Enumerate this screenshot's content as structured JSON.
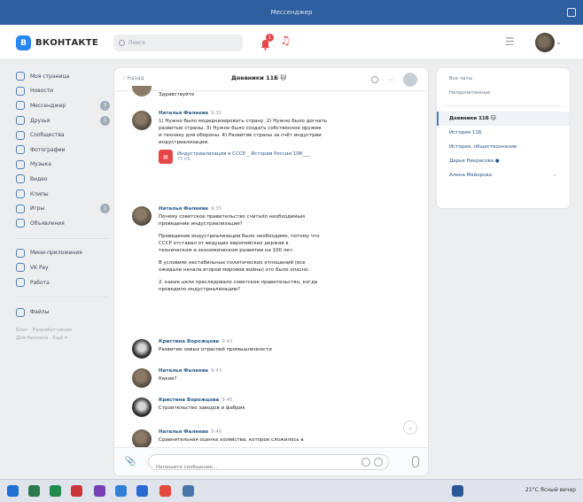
{
  "window": {
    "title": "Мессенджер"
  },
  "header": {
    "logo_text": "ВКОНТАКТЕ",
    "logo_letter": "В",
    "search_placeholder": "Поиск",
    "notif_count": "1",
    "accent": "#2787f5"
  },
  "leftnav": {
    "items": [
      {
        "label": "Моя страница",
        "icon": "home-icon"
      },
      {
        "label": "Новости",
        "icon": "news-icon"
      },
      {
        "label": "Мессенджер",
        "icon": "messenger-icon",
        "count": "3"
      },
      {
        "label": "Друзья",
        "icon": "friends-icon",
        "count": "1"
      },
      {
        "label": "Сообщества",
        "icon": "communities-icon"
      },
      {
        "label": "Фотографии",
        "icon": "photos-icon"
      },
      {
        "label": "Музыка",
        "icon": "music-icon"
      },
      {
        "label": "Видео",
        "icon": "video-icon"
      },
      {
        "label": "Клипы",
        "icon": "clips-icon"
      },
      {
        "label": "Игры",
        "icon": "games-icon",
        "count": "1"
      },
      {
        "label": "Объявления",
        "icon": "ads-icon"
      }
    ],
    "items2": [
      {
        "label": "Мини-приложения",
        "icon": "apps-icon"
      },
      {
        "label": "VK Pay",
        "icon": "pay-icon"
      },
      {
        "label": "Работа",
        "icon": "work-icon"
      }
    ],
    "items3": [
      {
        "label": "Файлы",
        "icon": "files-icon"
      }
    ],
    "footer": [
      "Блог · Разработчикам",
      "Для бизнеса · Ещё ▾"
    ]
  },
  "chat": {
    "back_label": "Назад",
    "title": "Дневники 11Б 🐱",
    "prev_line": "Здравствуйте",
    "messages": [
      {
        "author": "Наталья Фалеева",
        "time": "9:31",
        "lines": [
          "1) Нужно было модернизировать страну. 2) Нужно было догнать",
          "развитые страны. 3) Нужно было создать собственное оружие",
          "и технику для обороны. 4) Развитие страны за счёт индустрии",
          "индустриализации."
        ],
        "attachment": {
          "name": "Индустриализация в СССР _ История России 10К___",
          "size": "75 КБ"
        }
      },
      {
        "author": "Наталья Фалеева",
        "time": "9:35",
        "paras": [
          [
            "Почему советское правительство считало необходимым",
            "проведение индустриализации?"
          ],
          [
            "Проведение индустриализации было необходимо, потому что",
            "СССР отставал от ведущих европейских держав в",
            "техническом и экономическом развитии на 100 лет."
          ],
          [
            "В условиях нестабильных политических отношений (все",
            "ожидали начала второй мировой войны) это было опасно."
          ],
          [
            "2. какие цели преследовало советское правительство, когда",
            "проводило индустриализацию?"
          ]
        ]
      },
      {
        "author": "Кристина Ворожцова",
        "time": "9:42",
        "lines": [
          "Развитие новых отраслей промышленности"
        ]
      },
      {
        "author": "Наталья Фалеева",
        "time": "9:43",
        "lines": [
          "Какие?"
        ]
      },
      {
        "author": "Кристина Ворожцова",
        "time": "9:45",
        "lines": [
          "Строительство заводов и фабрик"
        ]
      },
      {
        "author": "Наталья Фалеева",
        "time": "9:46",
        "lines": [
          "Сравнительная оценка хозяйства, которое сложилось в"
        ]
      }
    ],
    "composer_placeholder": "Напишите сообщение..."
  },
  "rightpanel": {
    "top": [
      "Все чаты",
      "Непрочитанные"
    ],
    "chats": [
      {
        "label": "Дневники 11Б 🐱",
        "active": true
      },
      {
        "label": "История 11Б"
      },
      {
        "label": "История, обществознание"
      },
      {
        "label": "Дарья Некрасова ●"
      },
      {
        "label": "Алина Майорова",
        "chevron": true
      }
    ]
  },
  "taskbar": {
    "tray_text": "21°C Ясный вечер",
    "icons": [
      "windows-icon",
      "search-icon",
      "taskview-icon",
      "chrome-icon",
      "store-icon",
      "mail-icon",
      "explorer-icon",
      "yandex-icon",
      "vk-icon",
      "word-icon"
    ]
  }
}
